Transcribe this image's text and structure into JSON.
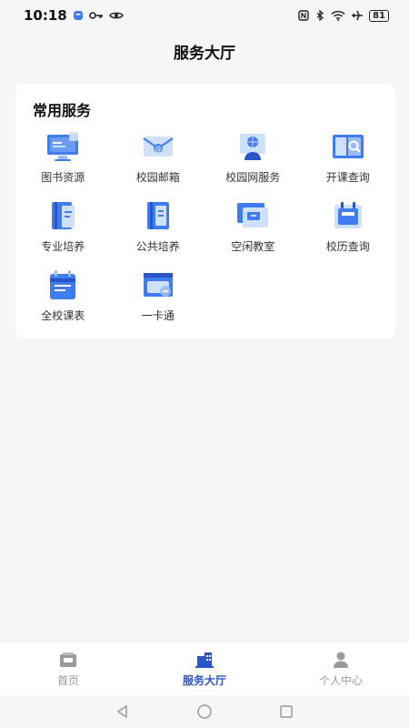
{
  "status_bar": {
    "time": "10:18",
    "battery": "81"
  },
  "header": {
    "title": "服务大厅"
  },
  "services_card": {
    "title": "常用服务",
    "items": [
      {
        "label": "图书资源",
        "icon": "library-monitor-icon"
      },
      {
        "label": "校园邮箱",
        "icon": "email-icon"
      },
      {
        "label": "校园网服务",
        "icon": "network-service-icon"
      },
      {
        "label": "开课查询",
        "icon": "course-search-icon"
      },
      {
        "label": "专业培养",
        "icon": "major-training-icon"
      },
      {
        "label": "公共培养",
        "icon": "public-training-icon"
      },
      {
        "label": "空闲教室",
        "icon": "free-classroom-icon"
      },
      {
        "label": "校历查询",
        "icon": "calendar-search-icon"
      },
      {
        "label": "全校课表",
        "icon": "timetable-icon"
      },
      {
        "label": "一卡通",
        "icon": "campus-card-icon"
      }
    ]
  },
  "tab_bar": {
    "tabs": [
      {
        "label": "首页",
        "icon": "home-icon",
        "active": false
      },
      {
        "label": "服务大厅",
        "icon": "service-hall-icon",
        "active": true
      },
      {
        "label": "个人中心",
        "icon": "person-icon",
        "active": false
      }
    ]
  },
  "colors": {
    "accent": "#2a55c9",
    "icon_blue": "#3f7cf0",
    "icon_light": "#cfe0fb",
    "background": "#f5f6f8"
  }
}
